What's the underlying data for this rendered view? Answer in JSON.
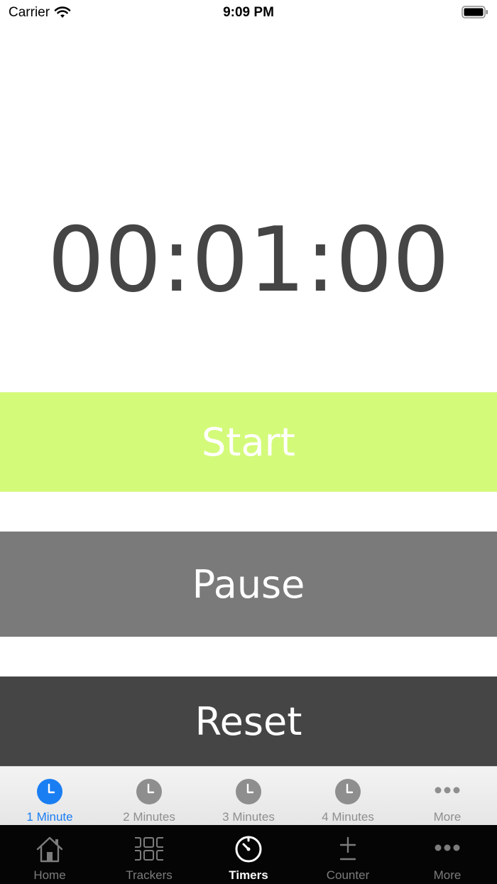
{
  "status_bar": {
    "carrier": "Carrier",
    "time": "9:09 PM"
  },
  "timer": {
    "display": "00:01:00"
  },
  "buttons": {
    "start": {
      "label": "Start",
      "color": "#d4fa7a"
    },
    "pause": {
      "label": "Pause",
      "color": "#7a7a7a"
    },
    "reset": {
      "label": "Reset",
      "color": "#454545"
    }
  },
  "timer_tabs": [
    {
      "label": "1 Minute",
      "icon": "clock-icon",
      "active": true
    },
    {
      "label": "2 Minutes",
      "icon": "clock-icon",
      "active": false
    },
    {
      "label": "3 Minutes",
      "icon": "clock-icon",
      "active": false
    },
    {
      "label": "4 Minutes",
      "icon": "clock-icon",
      "active": false
    },
    {
      "label": "More",
      "icon": "more-icon",
      "active": false
    }
  ],
  "main_tabs": [
    {
      "label": "Home",
      "icon": "home-icon",
      "active": false
    },
    {
      "label": "Trackers",
      "icon": "grid-icon",
      "active": false
    },
    {
      "label": "Timers",
      "icon": "timer-icon",
      "active": true
    },
    {
      "label": "Counter",
      "icon": "counter-icon",
      "active": false
    },
    {
      "label": "More",
      "icon": "more-icon",
      "active": false
    }
  ],
  "colors": {
    "active_tab": "#1a7ef3",
    "inactive_tab": "#8e8e8e"
  }
}
